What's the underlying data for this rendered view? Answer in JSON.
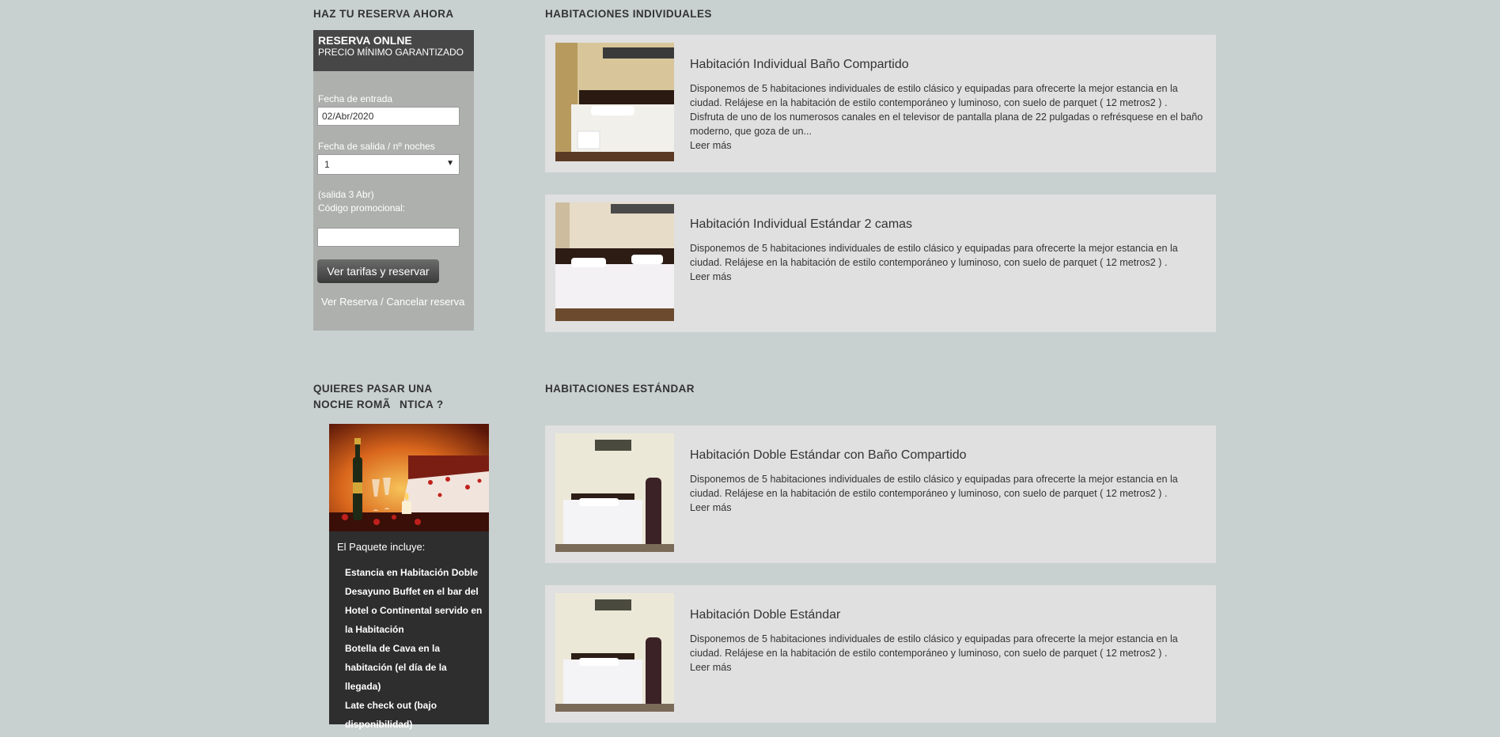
{
  "booking": {
    "heading": "HAZ TU RESERVA AHORA",
    "title": "RESERVA ONLNE",
    "subtitle": "PRECIO MÍNIMO GARANTIZADO",
    "checkin_label": "Fecha de entrada",
    "checkin_value": "02/Abr/2020",
    "checkout_label": "Fecha de salida / nº noches",
    "nights_value": "1",
    "checkout_note": "(salida 3 Abr)",
    "promo_label": "Código promocional:",
    "promo_value": "",
    "submit_label": "Ver tarifas y reservar",
    "manage_link": "Ver Reserva / Cancelar reserva"
  },
  "romantic": {
    "heading_line1": "QUIERES PASAR UNA",
    "heading_line2": "NOCHE ROMÃNTICA ?",
    "package_title": "El Paquete incluye:",
    "items": [
      "Estancia en Habitación Doble",
      "Desayuno Buffet en el bar del Hotel o Continental servido en la Habitación",
      "Botella de Cava en la habitación (el día de la llegada)",
      "Late check out (bajo disponibilidad)"
    ]
  },
  "sections": {
    "individual_heading": "HABITACIONES INDIVIDUALES",
    "standard_heading": "HABITACIONES ESTÁNDAR"
  },
  "rooms": [
    {
      "title": "Habitación Individual Baño Compartido",
      "description": "Disponemos de 5 habitaciones individuales de estilo clásico y equipadas para ofrecerte la mejor estancia en la ciudad. Relájese en la habitación de estilo contemporáneo y luminoso, con suelo de parquet ( 12 metros2 ) . Disfruta de uno de los numerosos canales en el televisor de pantalla plana de 22 pulgadas o refrésquese en el baño moderno, que goza de un...",
      "read_more": "Leer más"
    },
    {
      "title": "Habitación Individual Estándar 2 camas",
      "description": "Disponemos de 5 habitaciones individuales de estilo clásico y equipadas para ofrecerte la mejor estancia en la ciudad. Relájese en la habitación de estilo contemporáneo y luminoso, con suelo de parquet ( 12 metros2 ) .",
      "read_more": "Leer más"
    },
    {
      "title": "Habitación Doble Estándar con Baño Compartido",
      "description": "Disponemos de 5 habitaciones individuales de estilo clásico y equipadas para ofrecerte la mejor estancia en la ciudad. Relájese en la habitación de estilo contemporáneo y luminoso, con suelo de parquet ( 12 metros2 ) .",
      "read_more": "Leer más"
    },
    {
      "title": "Habitación Doble Estándar",
      "description": "Disponemos de 5 habitaciones individuales de estilo clásico y equipadas para ofrecerte la mejor estancia en la ciudad. Relájese en la habitación de estilo contemporáneo y luminoso, con suelo de parquet ( 12 metros2 ) .",
      "read_more": "Leer más"
    }
  ],
  "colors": {
    "page_bg": "#c9d0d0",
    "card_bg": "#e0e0e0",
    "widget_bg": "#aeb0ae",
    "widget_header": "#474747",
    "promo_bg": "#2e2e2e"
  }
}
